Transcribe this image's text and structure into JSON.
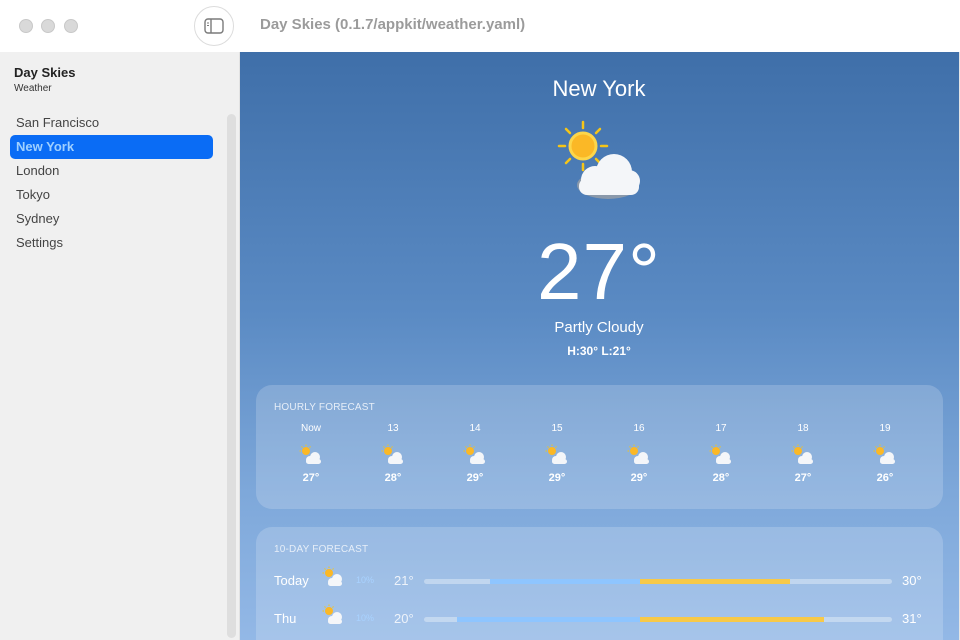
{
  "window": {
    "title": "Day Skies (0.1.7/appkit/weather.yaml)"
  },
  "sidebar": {
    "app_name": "Day Skies",
    "subtitle": "Weather",
    "items": [
      {
        "label": "San Francisco",
        "active": false
      },
      {
        "label": "New York",
        "active": true
      },
      {
        "label": "London",
        "active": false
      },
      {
        "label": "Tokyo",
        "active": false
      },
      {
        "label": "Sydney",
        "active": false
      },
      {
        "label": "Settings",
        "active": false
      }
    ]
  },
  "current": {
    "city": "New York",
    "icon": "partly-cloudy-icon",
    "temperature": "27°",
    "condition": "Partly Cloudy",
    "hilo": "H:30° L:21°"
  },
  "hourly": {
    "label": "HOURLY FORECAST",
    "items": [
      {
        "time": "Now",
        "temp": "27°"
      },
      {
        "time": "13",
        "temp": "28°"
      },
      {
        "time": "14",
        "temp": "29°"
      },
      {
        "time": "15",
        "temp": "29°"
      },
      {
        "time": "16",
        "temp": "29°"
      },
      {
        "time": "17",
        "temp": "28°"
      },
      {
        "time": "18",
        "temp": "27°"
      },
      {
        "time": "19",
        "temp": "26°"
      }
    ]
  },
  "daily": {
    "label": "10-DAY FORECAST",
    "items": [
      {
        "day": "Today",
        "precip": "10%",
        "low": "21°",
        "high": "30°"
      },
      {
        "day": "Thu",
        "precip": "10%",
        "low": "20°",
        "high": "31°"
      }
    ]
  },
  "colors": {
    "accent": "#0a6cf5",
    "bar_cool": "#8ec5ff",
    "bar_warm": "#f7c948"
  }
}
